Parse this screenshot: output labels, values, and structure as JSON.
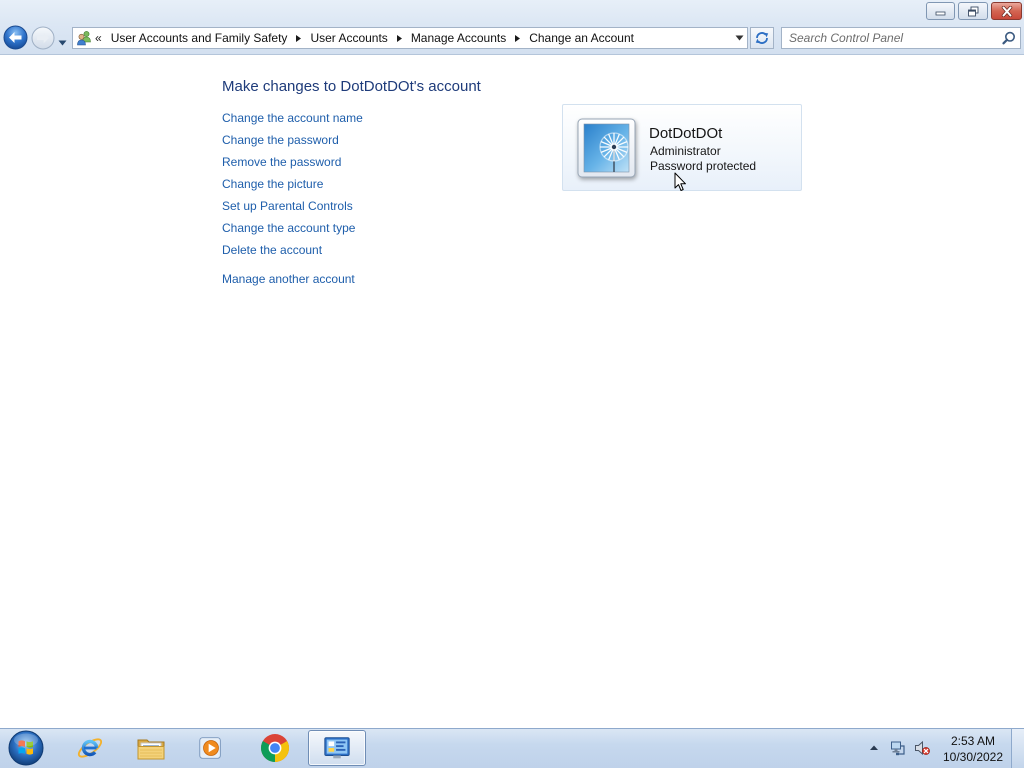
{
  "window": {
    "minimize_icon": "minimize-icon",
    "restore_icon": "restore-icon",
    "close_icon": "close-icon"
  },
  "nav": {
    "back_icon": "back-arrow-icon",
    "forward_icon": "forward-arrow-icon",
    "recent_pages_icon": "chevron-down-icon"
  },
  "address": {
    "location_icon": "user-accounts-icon",
    "overflow": "«",
    "crumbs": [
      "User Accounts and Family Safety",
      "User Accounts",
      "Manage Accounts",
      "Change an Account"
    ],
    "separator_icon": "chevron-right-icon",
    "dropdown_icon": "chevron-down-icon",
    "refresh_icon": "refresh-icon"
  },
  "search": {
    "placeholder": "Search Control Panel",
    "icon": "search-icon"
  },
  "main": {
    "heading": "Make changes to DotDotDOt's account",
    "tasks": [
      "Change the account name",
      "Change the password",
      "Remove the password",
      "Change the picture",
      "Set up Parental Controls",
      "Change the account type",
      "Delete the account"
    ],
    "other_task": "Manage another account"
  },
  "account": {
    "picture_icon": "account-picture",
    "name": "DotDotDOt",
    "type": "Administrator",
    "status": "Password protected"
  },
  "taskbar": {
    "start_icon": "windows-start-orb-icon",
    "pinned": [
      {
        "icon": "internet-explorer-icon",
        "active": false
      },
      {
        "icon": "windows-explorer-icon",
        "active": false
      },
      {
        "icon": "windows-media-player-icon",
        "active": false
      },
      {
        "icon": "google-chrome-icon",
        "active": false
      },
      {
        "icon": "control-panel-icon",
        "active": true
      }
    ],
    "tray_icons": [
      "show-hidden-icons-icon",
      "network-icon",
      "volume-muted-icon"
    ],
    "clock": {
      "time": "2:53 AM",
      "date": "10/30/2022"
    }
  },
  "colors": {
    "link": "#1e5eab",
    "heading": "#1e3b7a",
    "close_button": "#c9493b",
    "taskbar": "#bfd2ea"
  }
}
